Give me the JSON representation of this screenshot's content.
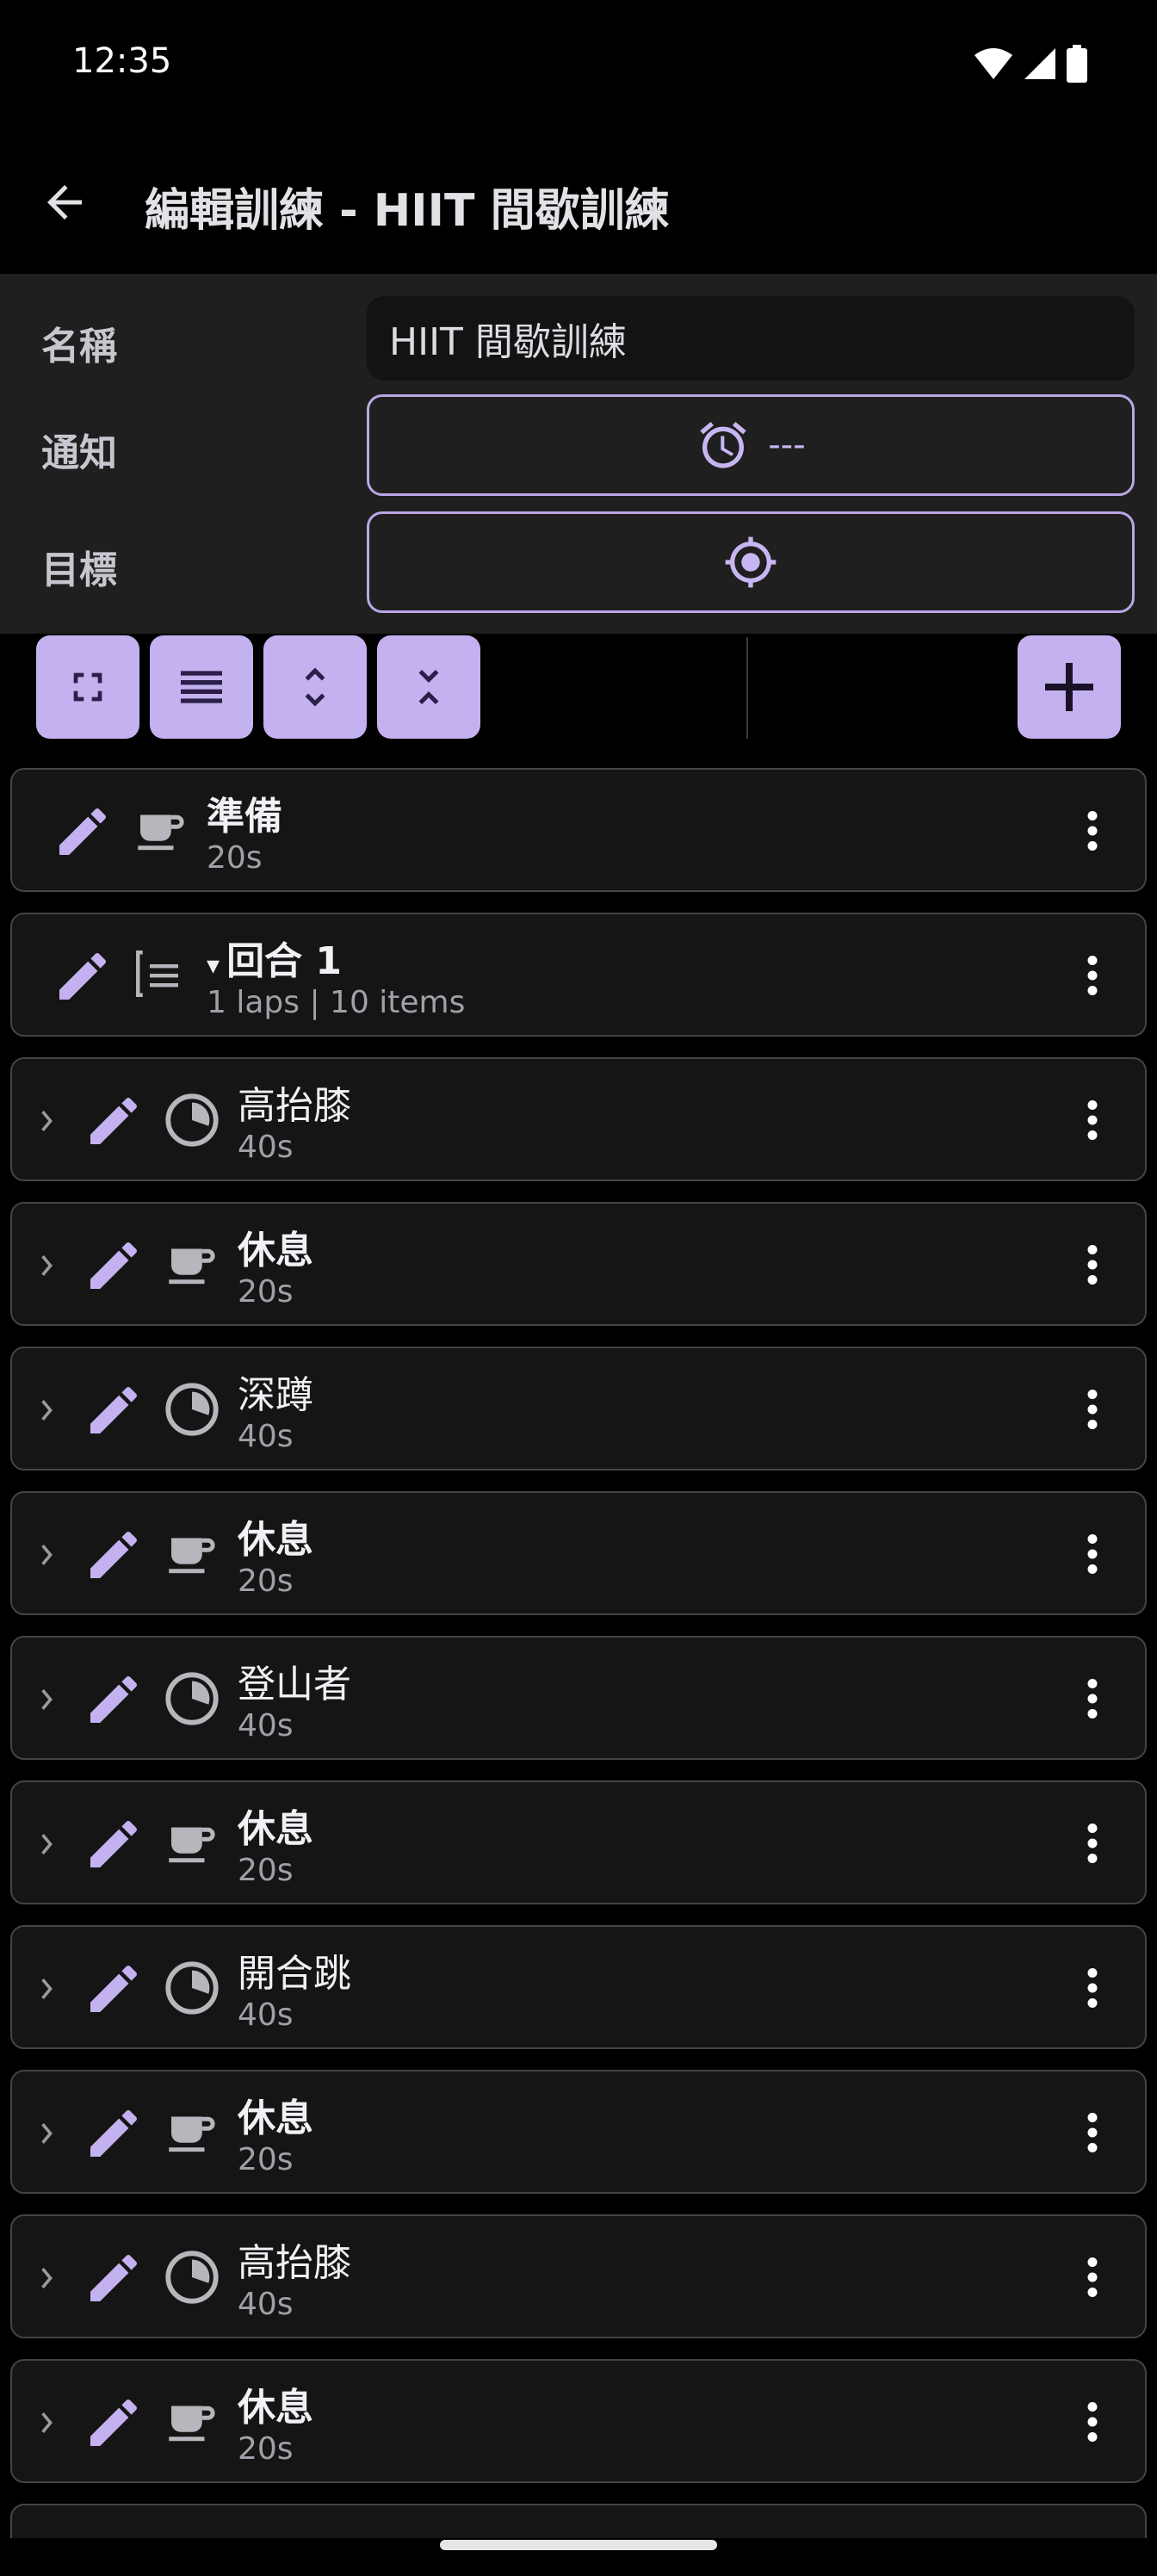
{
  "status_bar": {
    "time": "12:35"
  },
  "app_bar": {
    "title": "編輯訓練 - HIIT 間歇訓練"
  },
  "form": {
    "name_label": "名稱",
    "name_value": "HIIT 間歇訓練",
    "notify_label": "通知",
    "notify_value": "---",
    "target_label": "目標"
  },
  "colors": {
    "accent": "#c4b2f0",
    "accent_dark": "#2b1f4a",
    "surface": "#151515",
    "panel": "#1f1f1f"
  },
  "rows": [
    {
      "title": "準備",
      "sub": "20s",
      "icon": "coffee-cup-icon",
      "bold": true,
      "indent": 0
    },
    {
      "title": "回合 1",
      "sub": "1 laps | 10 items",
      "icon": "list-icon",
      "bold": true,
      "indent": 0,
      "expanded_marker": "▾"
    },
    {
      "title": "高抬膝",
      "sub": "40s",
      "icon": "pie-timer-icon",
      "bold": false,
      "indent": 1
    },
    {
      "title": "休息",
      "sub": "20s",
      "icon": "coffee-cup-icon",
      "bold": true,
      "indent": 1
    },
    {
      "title": "深蹲",
      "sub": "40s",
      "icon": "pie-timer-icon",
      "bold": false,
      "indent": 1
    },
    {
      "title": "休息",
      "sub": "20s",
      "icon": "coffee-cup-icon",
      "bold": true,
      "indent": 1
    },
    {
      "title": "登山者",
      "sub": "40s",
      "icon": "pie-timer-icon",
      "bold": false,
      "indent": 1
    },
    {
      "title": "休息",
      "sub": "20s",
      "icon": "coffee-cup-icon",
      "bold": true,
      "indent": 1
    },
    {
      "title": "開合跳",
      "sub": "40s",
      "icon": "pie-timer-icon",
      "bold": false,
      "indent": 1
    },
    {
      "title": "休息",
      "sub": "20s",
      "icon": "coffee-cup-icon",
      "bold": true,
      "indent": 1
    },
    {
      "title": "高抬膝",
      "sub": "40s",
      "icon": "pie-timer-icon",
      "bold": false,
      "indent": 1
    },
    {
      "title": "休息",
      "sub": "20s",
      "icon": "coffee-cup-icon",
      "bold": true,
      "indent": 1
    }
  ]
}
